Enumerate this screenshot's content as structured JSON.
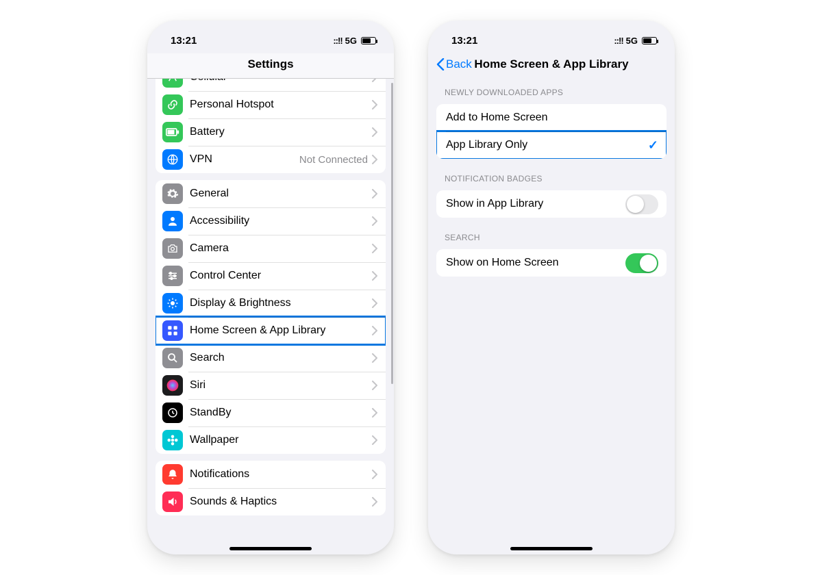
{
  "left": {
    "status": {
      "time": "13:21",
      "network": "5G"
    },
    "title": "Settings",
    "groups": [
      {
        "rows": [
          {
            "key": "cellular",
            "label": "Cellular",
            "icon_bg": "#34c759",
            "icon": "antenna"
          },
          {
            "key": "hotspot",
            "label": "Personal Hotspot",
            "icon_bg": "#34c759",
            "icon": "link"
          },
          {
            "key": "battery",
            "label": "Battery",
            "icon_bg": "#34c759",
            "icon": "battery"
          },
          {
            "key": "vpn",
            "label": "VPN",
            "icon_bg": "#007aff",
            "icon": "globe",
            "detail": "Not Connected"
          }
        ]
      },
      {
        "rows": [
          {
            "key": "general",
            "label": "General",
            "icon_bg": "#8e8e93",
            "icon": "gear"
          },
          {
            "key": "accessibility",
            "label": "Accessibility",
            "icon_bg": "#007aff",
            "icon": "person"
          },
          {
            "key": "camera",
            "label": "Camera",
            "icon_bg": "#8e8e93",
            "icon": "camera"
          },
          {
            "key": "controlcenter",
            "label": "Control Center",
            "icon_bg": "#8e8e93",
            "icon": "sliders"
          },
          {
            "key": "display",
            "label": "Display & Brightness",
            "icon_bg": "#007aff",
            "icon": "sun"
          },
          {
            "key": "homescreen",
            "label": "Home Screen & App Library",
            "icon_bg": "#3658ff",
            "icon": "apps",
            "highlight": true
          },
          {
            "key": "search",
            "label": "Search",
            "icon_bg": "#8e8e93",
            "icon": "search"
          },
          {
            "key": "siri",
            "label": "Siri",
            "icon_bg": "#1c1c1e",
            "icon": "siri"
          },
          {
            "key": "standby",
            "label": "StandBy",
            "icon_bg": "#000000",
            "icon": "clock"
          },
          {
            "key": "wallpaper",
            "label": "Wallpaper",
            "icon_bg": "#00c7d4",
            "icon": "flower"
          }
        ]
      },
      {
        "rows": [
          {
            "key": "notifications",
            "label": "Notifications",
            "icon_bg": "#ff3b30",
            "icon": "bell"
          },
          {
            "key": "sounds",
            "label": "Sounds & Haptics",
            "icon_bg": "#ff2d55",
            "icon": "speaker"
          }
        ]
      }
    ]
  },
  "right": {
    "status": {
      "time": "13:21",
      "network": "5G"
    },
    "back_label": "Back",
    "title": "Home Screen & App Library",
    "sections": [
      {
        "header": "Newly Downloaded Apps",
        "rows": [
          {
            "key": "add-home",
            "label": "Add to Home Screen",
            "type": "choice",
            "selected": false
          },
          {
            "key": "lib-only",
            "label": "App Library Only",
            "type": "choice",
            "selected": true,
            "highlight": true
          }
        ]
      },
      {
        "header": "Notification Badges",
        "rows": [
          {
            "key": "show-lib",
            "label": "Show in App Library",
            "type": "toggle",
            "on": false
          }
        ]
      },
      {
        "header": "Search",
        "rows": [
          {
            "key": "show-home",
            "label": "Show on Home Screen",
            "type": "toggle",
            "on": true
          }
        ]
      }
    ]
  }
}
